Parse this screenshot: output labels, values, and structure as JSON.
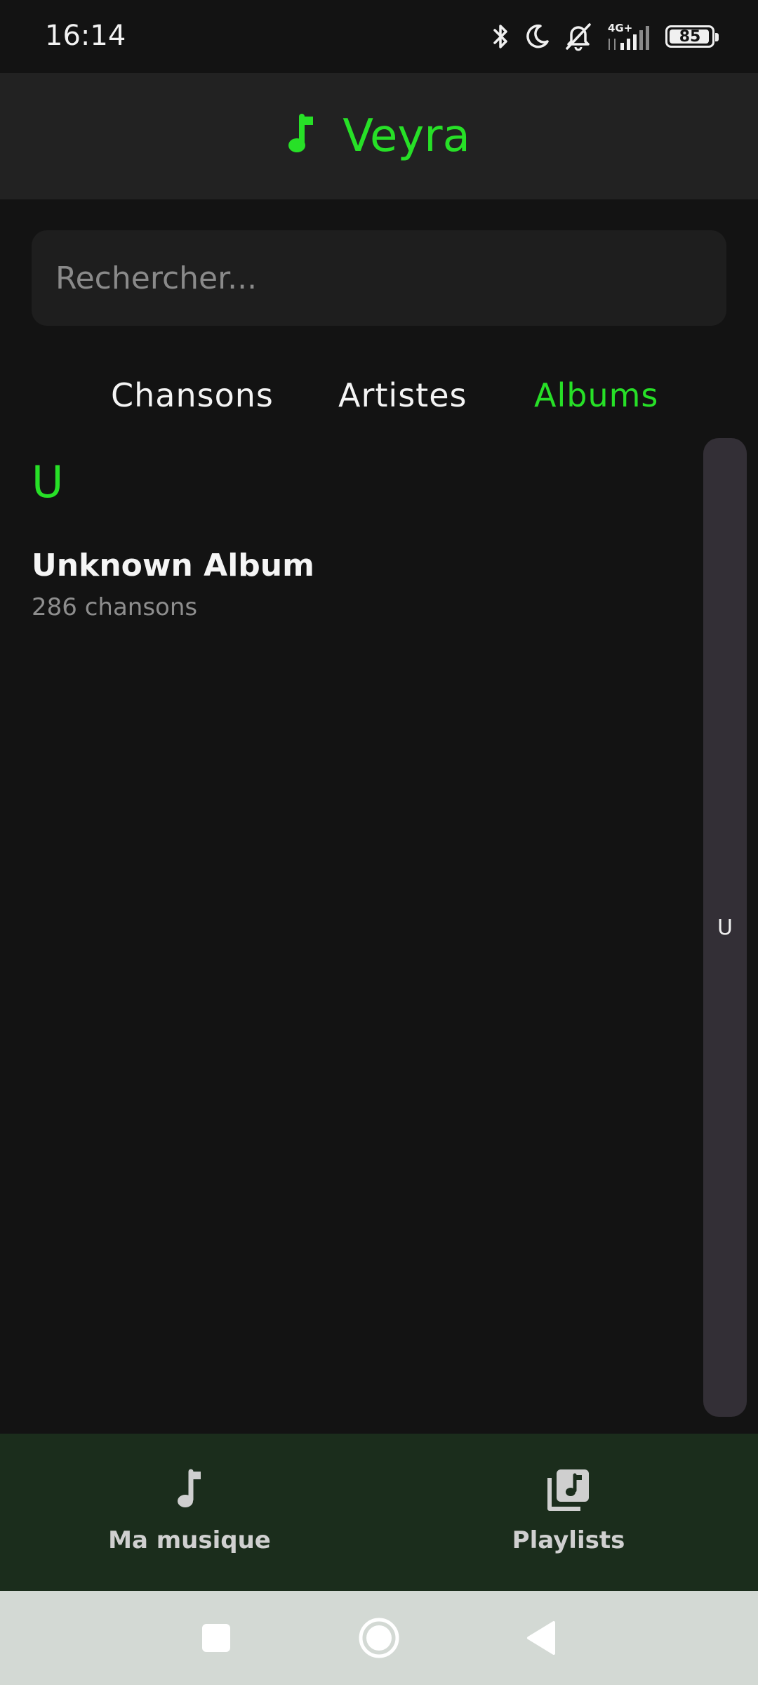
{
  "status_bar": {
    "time": "16:14",
    "network": "4G+",
    "battery_level": "85",
    "icons": [
      "bluetooth-icon",
      "moon-icon",
      "mute-icon",
      "signal-icon",
      "battery-icon"
    ]
  },
  "header": {
    "app_name": "Veyra",
    "icon": "music-note-icon",
    "accent_color": "#27e027"
  },
  "search": {
    "placeholder": "Rechercher...",
    "value": ""
  },
  "tabs": [
    {
      "label": "Chansons",
      "active": false
    },
    {
      "label": "Artistes",
      "active": false
    },
    {
      "label": "Albums",
      "active": true
    }
  ],
  "albums": {
    "section_letter": "U",
    "items": [
      {
        "title": "Unknown Album",
        "count": "286 chansons"
      }
    ]
  },
  "fast_scroll": {
    "letters": [
      "U"
    ]
  },
  "bottom_nav": {
    "items": [
      {
        "label": "Ma musique",
        "icon": "music-note-icon"
      },
      {
        "label": "Playlists",
        "icon": "library-music-icon"
      }
    ]
  },
  "system_nav": {
    "buttons": [
      "recents-button",
      "home-button",
      "back-button"
    ]
  }
}
